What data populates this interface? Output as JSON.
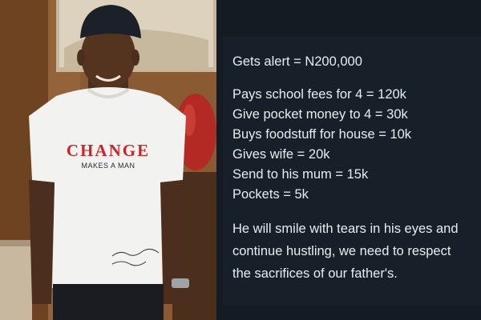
{
  "photo": {
    "shirt_main_text": "CHANGE",
    "shirt_sub_text": "MAKES A MAN"
  },
  "post": {
    "alert_line": "Gets alert = N200,000",
    "expenses": [
      "Pays school fees for 4 = 120k",
      "Give pocket money to 4 = 30k",
      "Buys foodstuff for house = 10k",
      "Gives wife = 20k",
      "Send to his mum = 15k",
      "Pockets =  5k"
    ],
    "closing_lines": [
      "He will smile with tears in his eyes and",
      "continue hustling, we need to respect",
      "the sacrifices of our father's."
    ]
  },
  "colors": {
    "panel_bg": "#141b22",
    "card_bg": "#172029",
    "text": "#e8ecef",
    "shirt_accent": "#c9252b"
  }
}
